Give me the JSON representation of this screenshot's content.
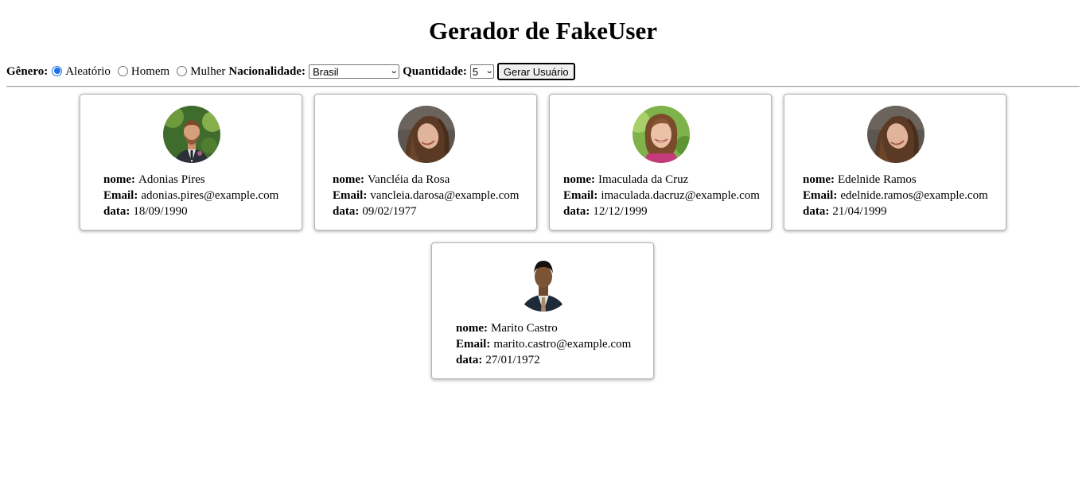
{
  "header": {
    "title": "Gerador de FakeUser"
  },
  "controls": {
    "genero_label": "Gênero:",
    "genero_options": [
      "Aleatório",
      "Homem",
      "Mulher"
    ],
    "genero_selected": "Aleatório",
    "nacionalidade_label": "Nacionalidade:",
    "nacionalidade_value": "Brasil",
    "quantidade_label": "Quantidade:",
    "quantidade_value": "5",
    "gerar_button": "Gerar Usuário"
  },
  "field_labels": {
    "nome": "nome:",
    "email": "Email:",
    "data": "data:"
  },
  "users": [
    {
      "nome": "Adonias Pires",
      "email": "adonias.pires@example.com",
      "data": "18/09/1990",
      "avatar": "man-beard-suit-photo"
    },
    {
      "nome": "Vancléia da Rosa",
      "email": "vancleia.darosa@example.com",
      "data": "09/02/1977",
      "avatar": "woman-curly-hair-photo"
    },
    {
      "nome": "Imaculada da Cruz",
      "email": "imaculada.dacruz@example.com",
      "data": "12/12/1999",
      "avatar": "woman-smiling-photo"
    },
    {
      "nome": "Edelnide Ramos",
      "email": "edelnide.ramos@example.com",
      "data": "21/04/1999",
      "avatar": "woman-curly-hair-photo"
    },
    {
      "nome": "Marito Castro",
      "email": "marito.castro@example.com",
      "data": "27/01/1972",
      "avatar": "man-suit-tie-photo"
    }
  ],
  "colors": {
    "radio_accent": "#1a73e8",
    "card_border": "#b5b5b5"
  }
}
